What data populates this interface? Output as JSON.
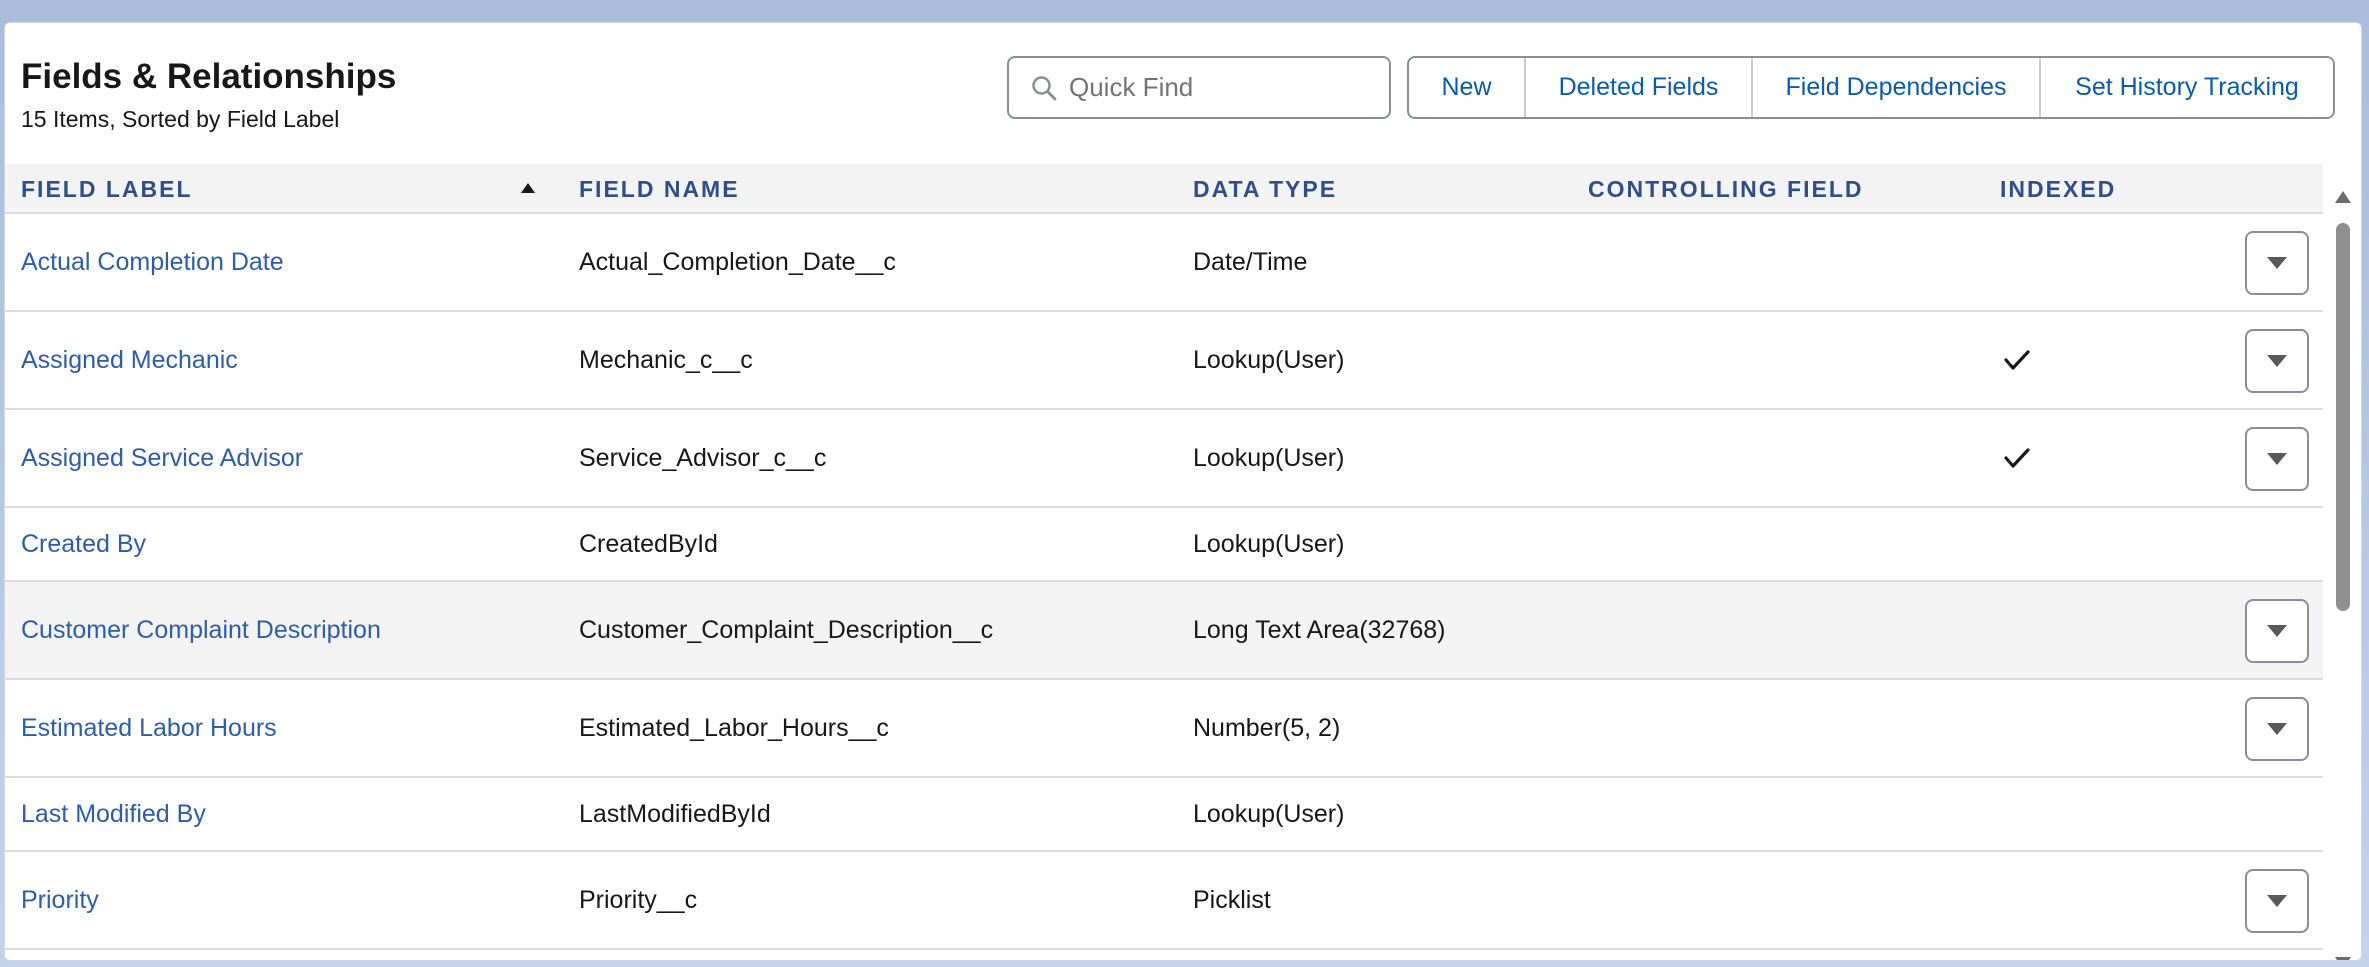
{
  "header": {
    "title": "Fields & Relationships",
    "subtitle": "15 Items, Sorted by Field Label"
  },
  "search": {
    "placeholder": "Quick Find"
  },
  "toolbar": {
    "new_label": "New",
    "deleted_fields_label": "Deleted Fields",
    "field_dependencies_label": "Field Dependencies",
    "set_history_tracking_label": "Set History Tracking"
  },
  "table": {
    "columns": {
      "field_label": "FIELD LABEL",
      "field_name": "FIELD NAME",
      "data_type": "DATA TYPE",
      "controlling_field": "CONTROLLING FIELD",
      "indexed": "INDEXED"
    },
    "sort": {
      "column": "field_label",
      "direction": "ascending"
    },
    "rows": [
      {
        "label": "Actual Completion Date",
        "name": "Actual_Completion_Date__c",
        "type": "Date/Time",
        "controlling": "",
        "indexed": false,
        "has_action": true
      },
      {
        "label": "Assigned Mechanic",
        "name": "Mechanic_c__c",
        "type": "Lookup(User)",
        "controlling": "",
        "indexed": true,
        "has_action": true
      },
      {
        "label": "Assigned Service Advisor",
        "name": "Service_Advisor_c__c",
        "type": "Lookup(User)",
        "controlling": "",
        "indexed": true,
        "has_action": true
      },
      {
        "label": "Created By",
        "name": "CreatedById",
        "type": "Lookup(User)",
        "controlling": "",
        "indexed": false,
        "has_action": false
      },
      {
        "label": "Customer Complaint Description",
        "name": "Customer_Complaint_Description__c",
        "type": "Long Text Area(32768)",
        "controlling": "",
        "indexed": false,
        "has_action": true
      },
      {
        "label": "Estimated Labor Hours",
        "name": "Estimated_Labor_Hours__c",
        "type": "Number(5, 2)",
        "controlling": "",
        "indexed": false,
        "has_action": true
      },
      {
        "label": "Last Modified By",
        "name": "LastModifiedById",
        "type": "Lookup(User)",
        "controlling": "",
        "indexed": false,
        "has_action": false
      },
      {
        "label": "Priority",
        "name": "Priority__c",
        "type": "Picklist",
        "controlling": "",
        "indexed": false,
        "has_action": true
      }
    ]
  },
  "icons": {
    "search": "search-icon",
    "sort": "sort-ascending-icon",
    "row_action": "chevron-down-icon",
    "indexed": "checkmark-icon"
  },
  "colors": {
    "link": "#2e5ea7",
    "header_text": "#2e4f8a",
    "button_text": "#0b5cab"
  }
}
